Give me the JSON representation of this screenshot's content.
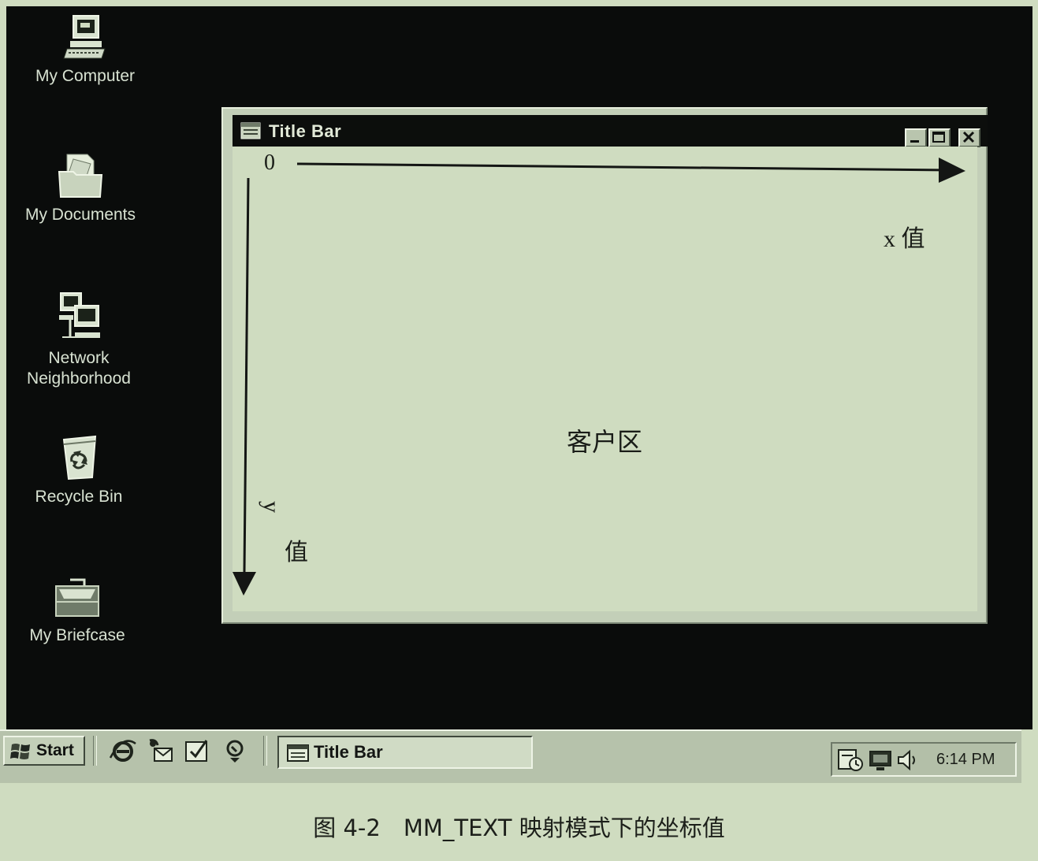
{
  "desktop": {
    "icons": [
      {
        "label": "My Computer",
        "icon": "computer-icon"
      },
      {
        "label": "My Documents",
        "icon": "folder-documents-icon"
      },
      {
        "label": "Network\nNeighborhood",
        "icon": "network-icon"
      },
      {
        "label": "Recycle Bin",
        "icon": "recycle-bin-icon"
      },
      {
        "label": "My Briefcase",
        "icon": "briefcase-icon"
      }
    ]
  },
  "window": {
    "title": "Title Bar",
    "buttons": [
      "minimize-icon",
      "maximize-icon",
      "close-icon"
    ],
    "client": {
      "origin_label": "0",
      "x_axis_label": "x 值",
      "y_axis_label_letter": "y",
      "y_axis_label_char": "值",
      "area_label": "客户区"
    }
  },
  "taskbar": {
    "start_label": "Start",
    "quick_launch": [
      "internet-explorer-icon",
      "outlook-express-icon",
      "show-desktop-icon",
      "channels-icon"
    ],
    "task_button_label": "Title Bar",
    "tray_icons": [
      "scheduler-icon",
      "display-icon",
      "volume-icon"
    ],
    "clock": "6:14 PM"
  },
  "caption": "图 4-2　MM_TEXT 映射模式下的坐标值",
  "colors": {
    "desktop": "#0a0c0b",
    "paper": "#cfdcc0",
    "titlebar": "#0c0e0c",
    "taskbar": "#b6c2ab"
  }
}
